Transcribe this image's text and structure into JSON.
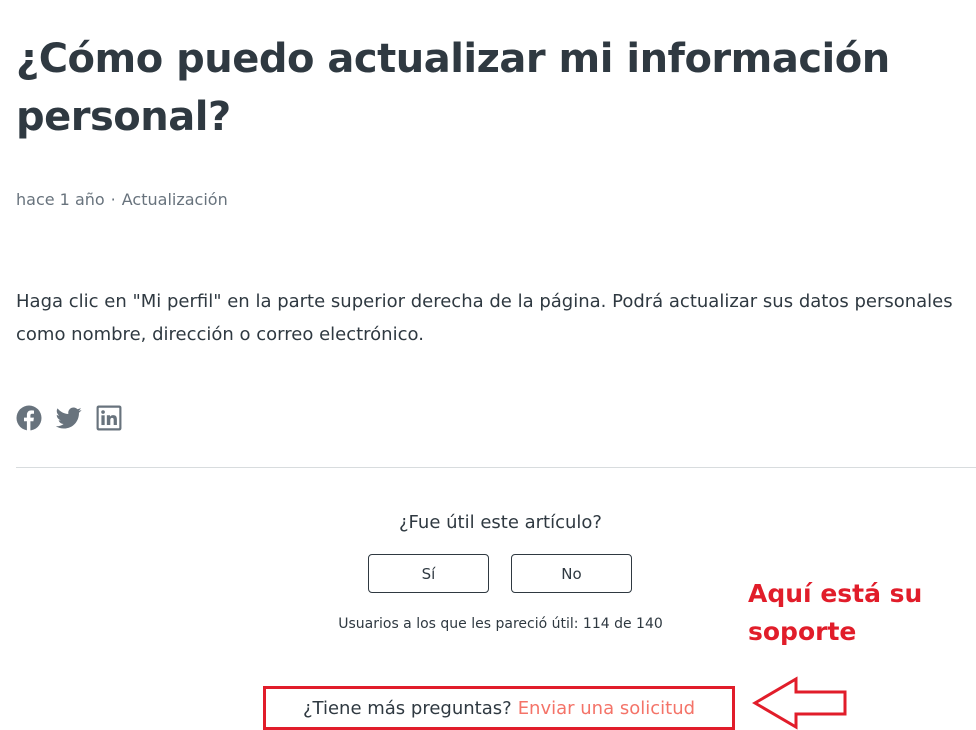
{
  "article": {
    "title": "¿Cómo puedo actualizar mi información personal?",
    "meta": {
      "time": "hace 1 año",
      "separator": "·",
      "section": "Actualización"
    },
    "body": "Haga clic en \"Mi perfil\" en la parte superior derecha de la página. Podrá actualizar sus datos personales como nombre, dirección o correo electrónico."
  },
  "share": {
    "items": [
      {
        "icon": "facebook-icon"
      },
      {
        "icon": "twitter-icon"
      },
      {
        "icon": "linkedin-icon"
      }
    ],
    "icon_color": "#68737d"
  },
  "vote": {
    "question": "¿Fue útil este artículo?",
    "yes_label": "Sí",
    "no_label": "No",
    "count_text": "Usuarios a los que les pareció útil: 114 de 140"
  },
  "request": {
    "question": "¿Tiene más preguntas?",
    "link_label": "Enviar una solicitud",
    "link_color": "#f47368"
  },
  "annotation": {
    "text": "Aquí está su soporte",
    "color": "#e11d2a"
  }
}
